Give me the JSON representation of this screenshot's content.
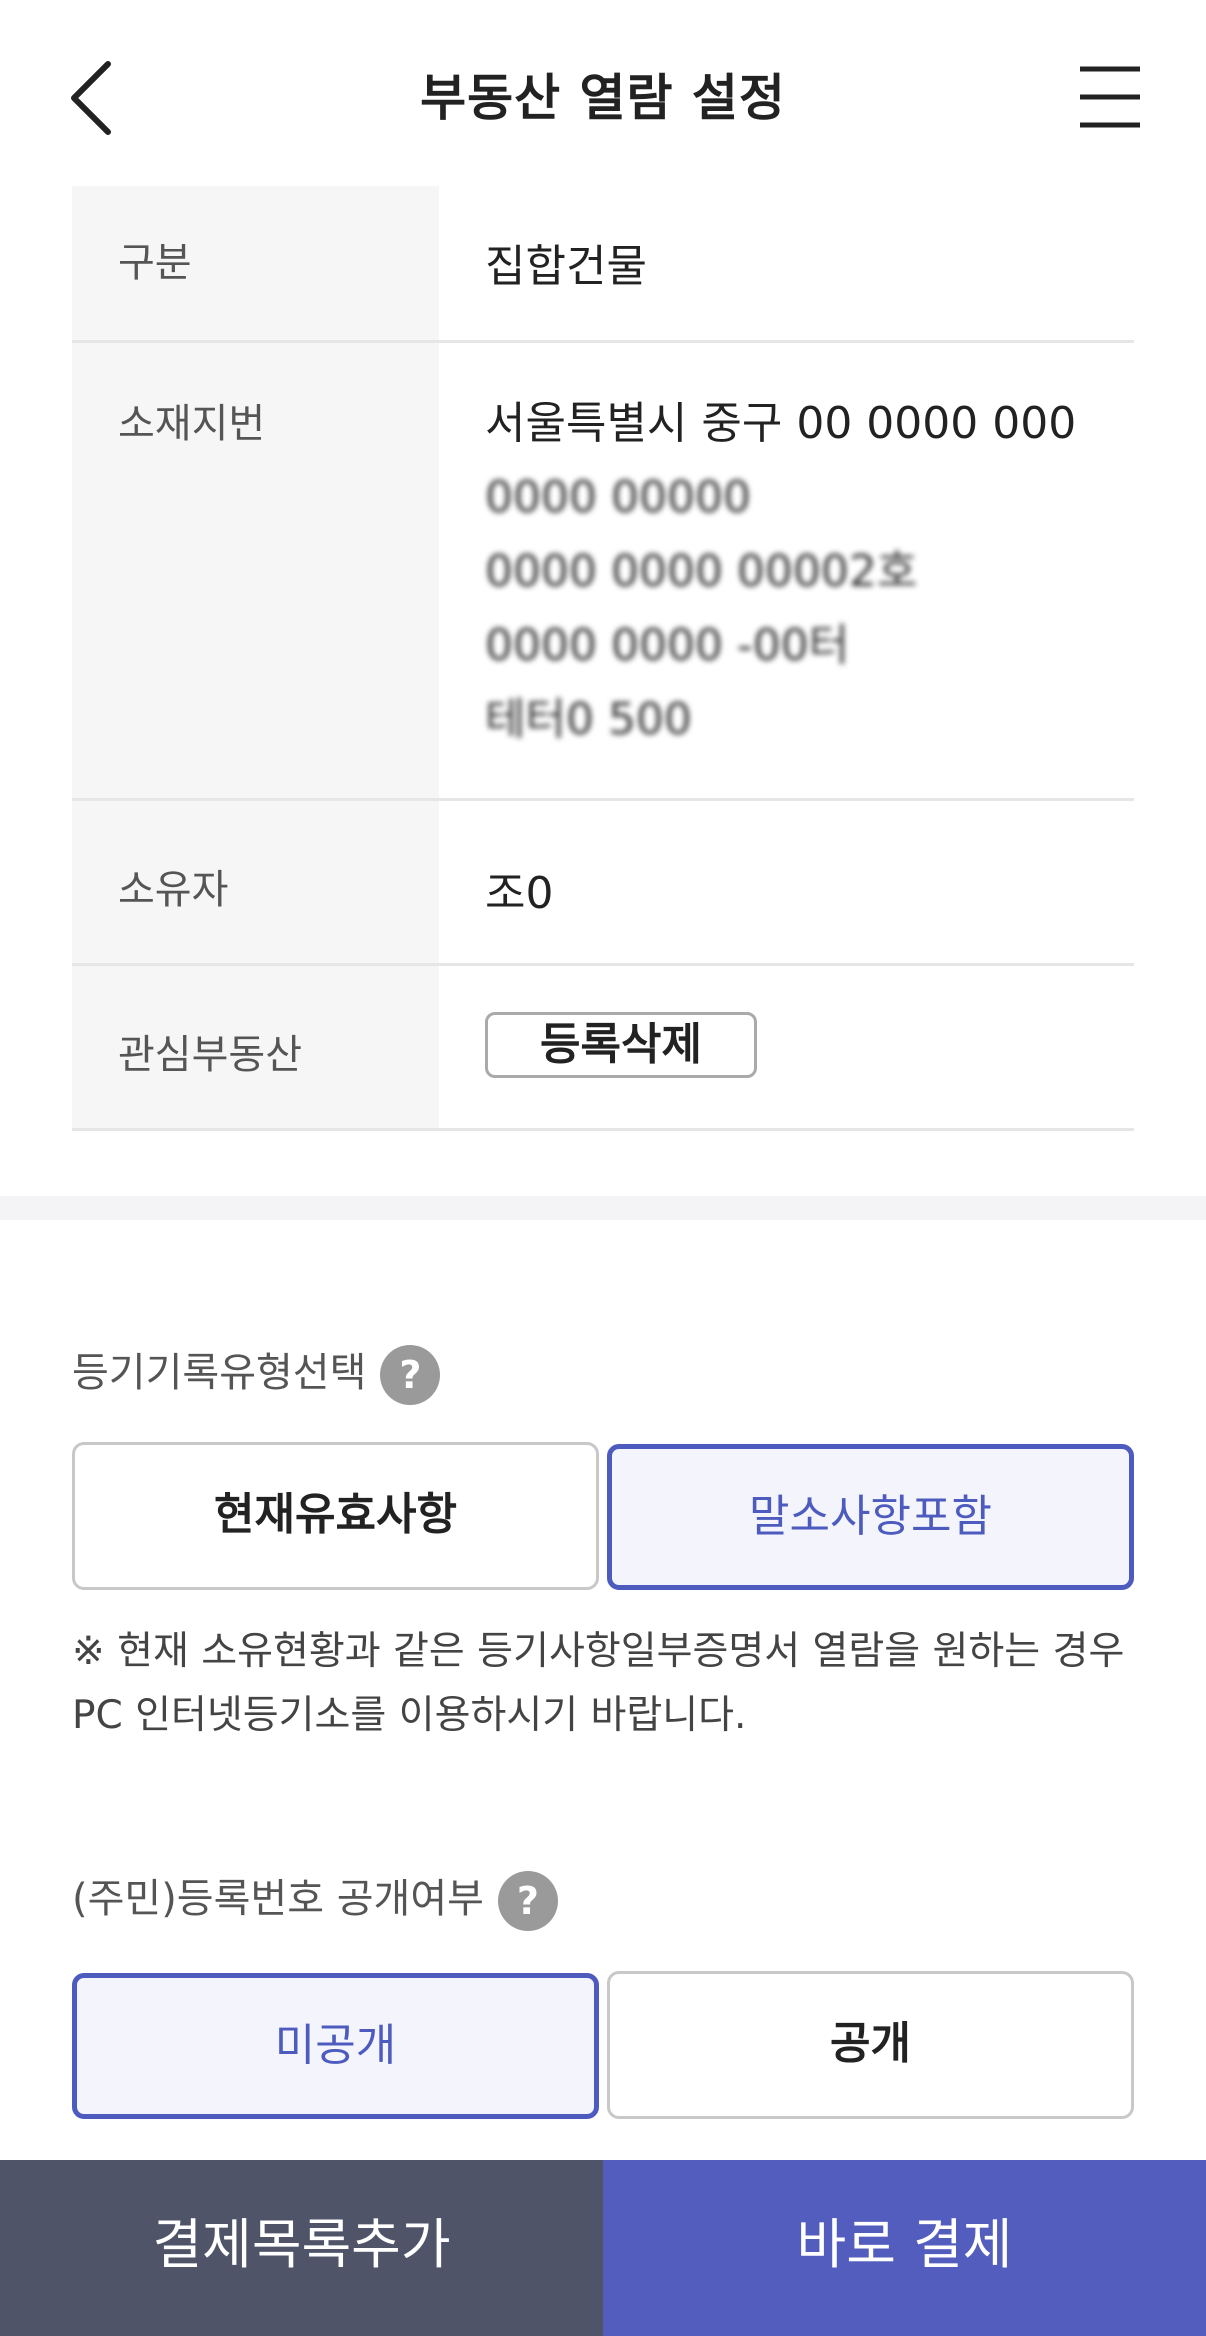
{
  "header": {
    "title": "부동산 열람 설정",
    "back_icon": "chevron-left-icon",
    "menu_icon": "hamburger-menu-icon"
  },
  "info": {
    "type_label": "구분",
    "type_value": "집합건물",
    "address_label": "소재지번",
    "address_lines": [
      "서울특별시 중구 00 0000 000",
      "0000           00000",
      "0000 0000 00002호",
      "0000  0000  -00터",
      "테터0    500"
    ],
    "owner_label": "소유자",
    "owner_value": "조0",
    "interest_label": "관심부동산",
    "interest_button": "등록삭제"
  },
  "registry_type": {
    "label": "등기기록유형선택",
    "help": "?",
    "option_current": "현재유효사항",
    "option_include": "말소사항포함",
    "selected": "말소사항포함",
    "notice_line1": "※ 현재 소유현황과 같은 등기사항일부증명서 열람을 원하는 경우",
    "notice_line2": "PC 인터넷등기소를 이용하시기 바랍니다."
  },
  "id_disclosure": {
    "label": "(주민)등록번호 공개여부",
    "help": "?",
    "option_hidden": "미공개",
    "option_public": "공개",
    "selected": "미공개"
  },
  "bottom": {
    "add_to_list": "결제목록추가",
    "pay_now": "바로 결제"
  },
  "colors": {
    "accent": "#4d5bbf",
    "bottom_left_bg": "#4f5468",
    "bottom_right_bg": "#535dbd"
  }
}
